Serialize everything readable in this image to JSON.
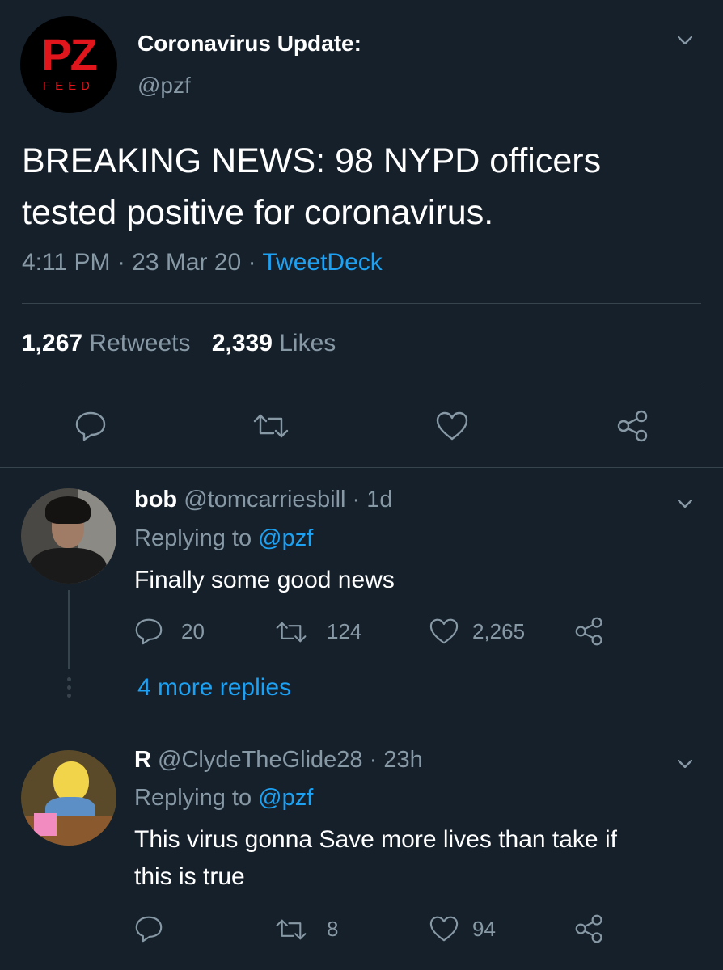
{
  "main_tweet": {
    "logo": {
      "letters": "PZ",
      "sub": "FEED",
      "logo_color": "#e0161c"
    },
    "display_name": "Coronavirus Update:",
    "handle": "@pzf",
    "text_line1": "BREAKING NEWS: 98 NYPD officers",
    "text_line2": "tested positive for coronavirus.",
    "time": "4:11 PM",
    "date": "23 Mar 20",
    "source": "TweetDeck",
    "retweets_count": "1,267",
    "retweets_label": "Retweets",
    "likes_count": "2,339",
    "likes_label": "Likes"
  },
  "replies": [
    {
      "name": "bob",
      "handle": "@tomcarriesbill",
      "age": "1d",
      "replying_prefix": "Replying to",
      "replying_to": "@pzf",
      "text": "Finally some good news",
      "reply_count": "20",
      "retweet_count": "124",
      "like_count": "2,265",
      "more_replies": "4 more replies"
    },
    {
      "name": "R",
      "handle": "@ClydeTheGlide28",
      "age": "23h",
      "replying_prefix": "Replying to",
      "replying_to": "@pzf",
      "text_line1": "This virus gonna Save more lives than take if",
      "text_line2": "this is true",
      "retweet_count": "8",
      "like_count": "94"
    }
  ],
  "colors": {
    "background": "#15202b",
    "muted": "#8899a6",
    "accent": "#1da1f2",
    "divider": "#38444d"
  }
}
